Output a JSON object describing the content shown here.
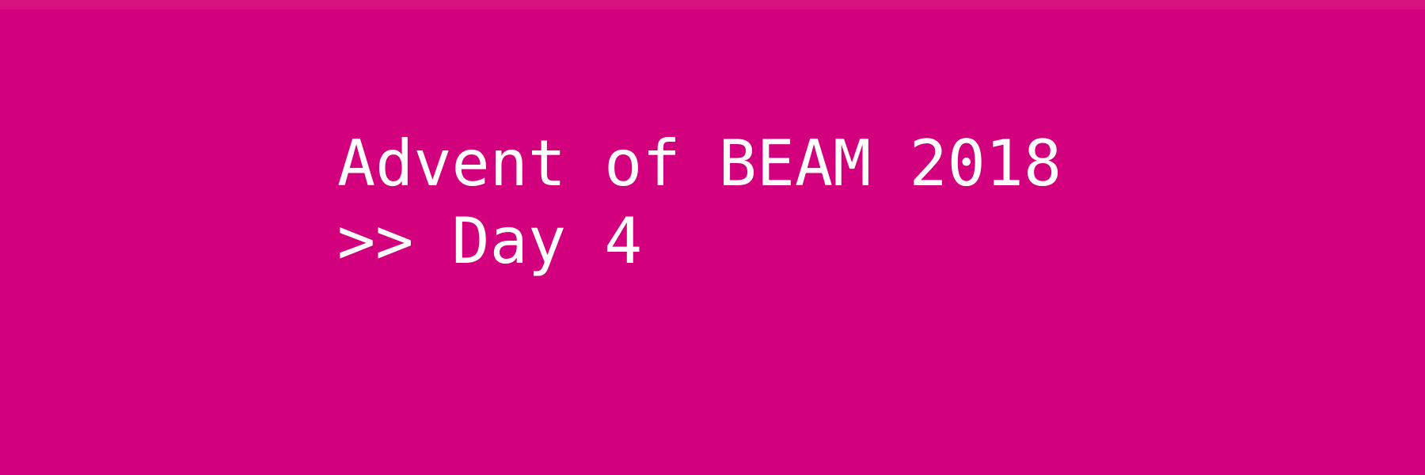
{
  "banner": {
    "title": "Advent of BEAM 2018",
    "subtitle": ">> Day 4"
  },
  "colors": {
    "background": "#d2007c",
    "top_strip": "#d6127f",
    "text": "#ffffff"
  }
}
